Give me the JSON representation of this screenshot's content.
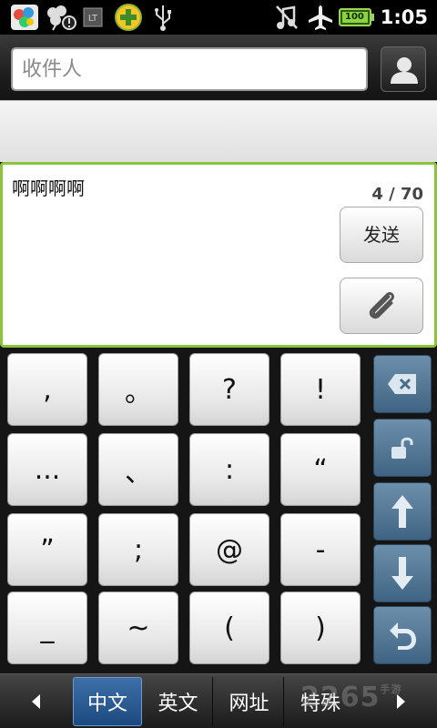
{
  "status_bar": {
    "time": "1:05",
    "battery_level": "100",
    "icons": [
      "app-grid-icon",
      "clover-warning-icon",
      "lt-icon",
      "plus-badge-icon",
      "usb-icon",
      "music-off-icon",
      "airplane-icon",
      "battery-icon"
    ]
  },
  "header": {
    "recipient_placeholder": "收件人"
  },
  "compose": {
    "text": "啊啊啊啊",
    "char_count": "4 / 70",
    "send_label": "发送"
  },
  "keyboard": {
    "symbols": [
      ",",
      "。",
      "?",
      "!",
      "...",
      "、",
      ":",
      "“",
      "”",
      ";",
      "@",
      "-",
      "_",
      "~",
      "(",
      ")"
    ],
    "function_keys": [
      "backspace-icon",
      "unlock-icon",
      "arrow-up-icon",
      "arrow-down-icon",
      "return-icon"
    ]
  },
  "mode_bar": {
    "modes": [
      "中文",
      "英文",
      "网址",
      "特殊"
    ],
    "active_mode": "中文",
    "watermark": "2265",
    "watermark_small": "手游"
  },
  "colors": {
    "compose_border": "#8bc33a",
    "active_mode": "#2a5b94",
    "function_key": "#5a7d9c"
  }
}
